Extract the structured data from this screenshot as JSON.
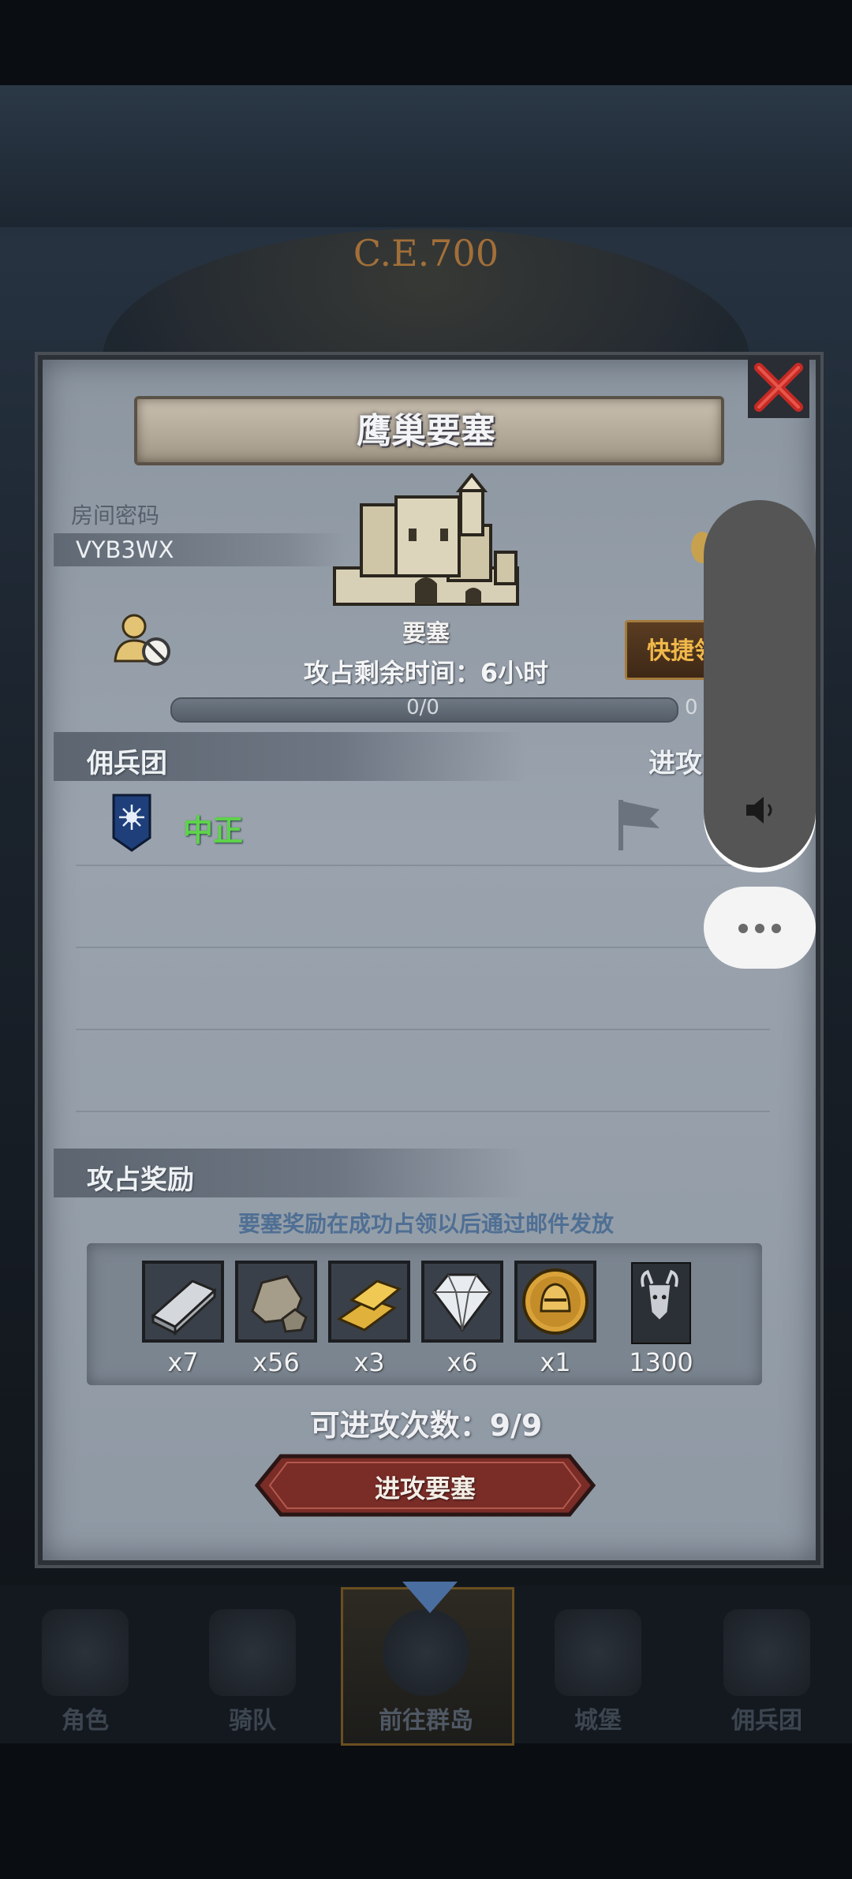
{
  "background": {
    "era_label": "C.E.700"
  },
  "modal": {
    "title": "鹰巢要塞",
    "room_code_label": "房间密码",
    "room_code": "VYB3WX",
    "building_label": "要塞",
    "occupation_time": "攻占剩余时间：6小时",
    "progress_text": "0/0",
    "progress_right": "0",
    "shortcut_button": "快捷领",
    "mercenary_header": "佣兵团",
    "attack_header": "进攻",
    "mercenary_rows": [
      {
        "faction": "中正"
      }
    ],
    "reward_header": "攻占奖励",
    "reward_note": "要塞奖励在成功占领以后通过邮件发放",
    "rewards": [
      {
        "icon": "silver-ingot-icon",
        "qty": "x7"
      },
      {
        "icon": "stone-icon",
        "qty": "x56"
      },
      {
        "icon": "gold-bar-icon",
        "qty": "x3"
      },
      {
        "icon": "diamond-icon",
        "qty": "x6"
      },
      {
        "icon": "knight-helmet-coin-icon",
        "qty": "x1"
      },
      {
        "icon": "minotaur-banner-icon",
        "qty": "1300"
      }
    ],
    "attempts": "可进攻次数：9/9",
    "attack_button": "进攻要塞"
  },
  "nav": {
    "items": [
      {
        "label": "角色"
      },
      {
        "label": "骑队"
      },
      {
        "label": "前往群岛"
      },
      {
        "label": "城堡"
      },
      {
        "label": "佣兵团"
      }
    ],
    "active_index": 2
  },
  "colors": {
    "faction_green": "#5ed34a",
    "note_blue": "#4f6f94",
    "shortcut_gold": "#f0b84a"
  }
}
